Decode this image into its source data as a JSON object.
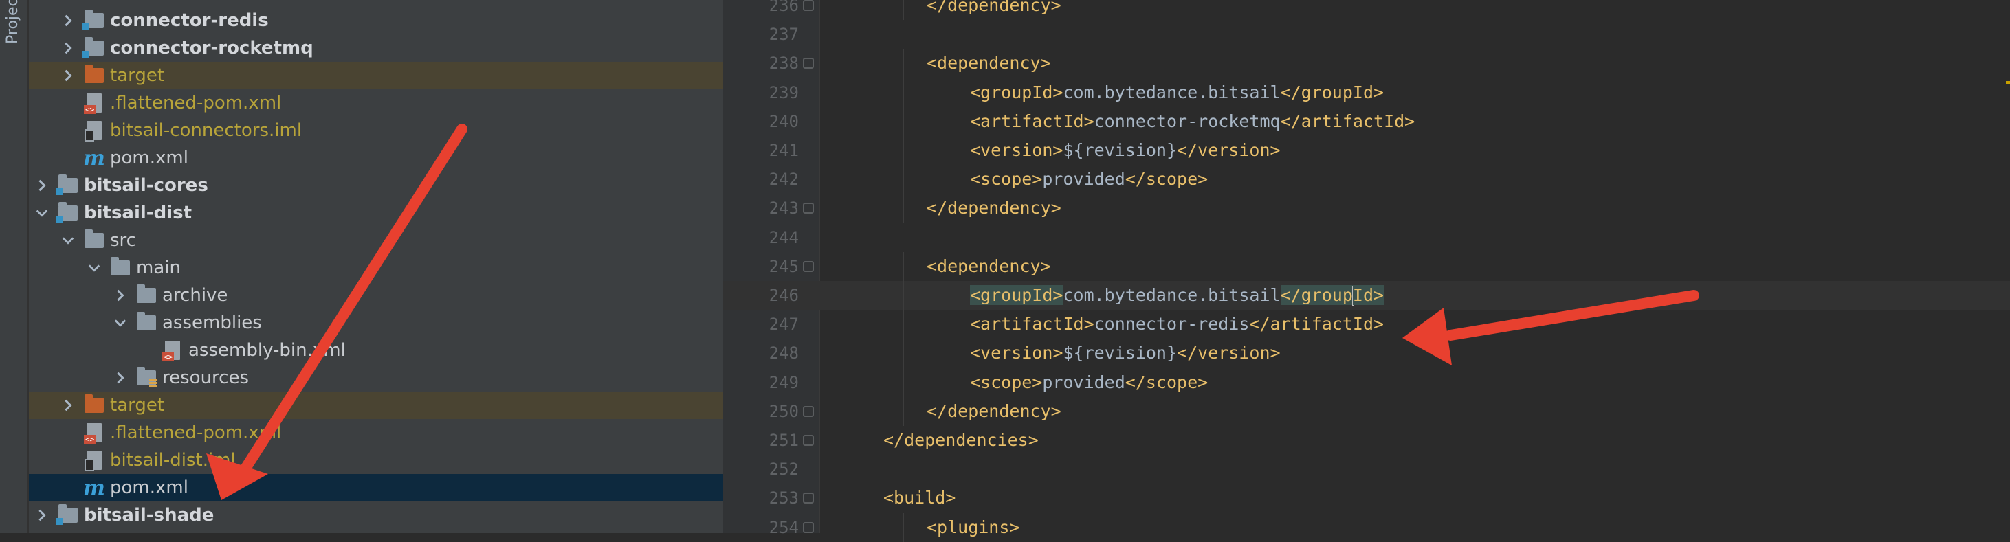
{
  "tool_window": {
    "label": "Project"
  },
  "project_tree": {
    "rows": [
      {
        "label": "connector-redis",
        "kind": "module",
        "indent": 1,
        "expander": "collapsed",
        "style": "bold",
        "state": ""
      },
      {
        "label": "connector-rocketmq",
        "kind": "module",
        "indent": 1,
        "expander": "collapsed",
        "style": "bold",
        "state": ""
      },
      {
        "label": "target",
        "kind": "folder-orange",
        "indent": 1,
        "expander": "collapsed",
        "style": "olive",
        "state": "excluded"
      },
      {
        "label": ".flattened-pom.xml",
        "kind": "xml",
        "indent": 1,
        "expander": "none",
        "style": "olive",
        "state": ""
      },
      {
        "label": "bitsail-connectors.iml",
        "kind": "iml",
        "indent": 1,
        "expander": "none",
        "style": "olive",
        "state": ""
      },
      {
        "label": "pom.xml",
        "kind": "maven",
        "indent": 1,
        "expander": "none",
        "style": "normal",
        "state": ""
      },
      {
        "label": "bitsail-cores",
        "kind": "module",
        "indent": 0,
        "expander": "collapsed",
        "style": "bold",
        "state": ""
      },
      {
        "label": "bitsail-dist",
        "kind": "module",
        "indent": 0,
        "expander": "expanded",
        "style": "bold",
        "state": ""
      },
      {
        "label": "src",
        "kind": "folder",
        "indent": 1,
        "expander": "expanded",
        "style": "normal",
        "state": ""
      },
      {
        "label": "main",
        "kind": "folder",
        "indent": 2,
        "expander": "expanded",
        "style": "normal",
        "state": ""
      },
      {
        "label": "archive",
        "kind": "folder",
        "indent": 3,
        "expander": "collapsed",
        "style": "normal",
        "state": ""
      },
      {
        "label": "assemblies",
        "kind": "folder",
        "indent": 3,
        "expander": "expanded",
        "style": "normal",
        "state": ""
      },
      {
        "label": "assembly-bin.xml",
        "kind": "xml",
        "indent": 4,
        "expander": "none",
        "style": "normal",
        "state": ""
      },
      {
        "label": "resources",
        "kind": "folder-res",
        "indent": 3,
        "expander": "collapsed",
        "style": "normal",
        "state": ""
      },
      {
        "label": "target",
        "kind": "folder-orange",
        "indent": 1,
        "expander": "collapsed",
        "style": "olive",
        "state": "excluded"
      },
      {
        "label": ".flattened-pom.xml",
        "kind": "xml",
        "indent": 1,
        "expander": "none",
        "style": "olive",
        "state": ""
      },
      {
        "label": "bitsail-dist.iml",
        "kind": "iml",
        "indent": 1,
        "expander": "none",
        "style": "olive",
        "state": ""
      },
      {
        "label": "pom.xml",
        "kind": "maven",
        "indent": 1,
        "expander": "none",
        "style": "normal",
        "state": "selected"
      },
      {
        "label": "bitsail-shade",
        "kind": "module",
        "indent": 0,
        "expander": "collapsed",
        "style": "bold",
        "state": ""
      }
    ]
  },
  "editor": {
    "caret_line": "246",
    "lines": [
      {
        "num": "236",
        "indent": 2,
        "fold": true,
        "tokens": [
          {
            "t": "tag",
            "v": "</dependency>"
          }
        ]
      },
      {
        "num": "237",
        "indent": 0,
        "fold": false,
        "tokens": []
      },
      {
        "num": "238",
        "indent": 2,
        "fold": true,
        "tokens": [
          {
            "t": "tag",
            "v": "<dependency>"
          }
        ]
      },
      {
        "num": "239",
        "indent": 3,
        "fold": false,
        "tokens": [
          {
            "t": "tag",
            "v": "<groupId>"
          },
          {
            "t": "txt",
            "v": "com.bytedance.bitsail"
          },
          {
            "t": "tag",
            "v": "</groupId>"
          }
        ]
      },
      {
        "num": "240",
        "indent": 3,
        "fold": false,
        "tokens": [
          {
            "t": "tag",
            "v": "<artifactId>"
          },
          {
            "t": "txt",
            "v": "connector-rocketmq"
          },
          {
            "t": "tag",
            "v": "</artifactId>"
          }
        ]
      },
      {
        "num": "241",
        "indent": 3,
        "fold": false,
        "tokens": [
          {
            "t": "tag",
            "v": "<version>"
          },
          {
            "t": "txt",
            "v": "${revision}"
          },
          {
            "t": "tag",
            "v": "</version>"
          }
        ]
      },
      {
        "num": "242",
        "indent": 3,
        "fold": false,
        "tokens": [
          {
            "t": "tag",
            "v": "<scope>"
          },
          {
            "t": "txt",
            "v": "provided"
          },
          {
            "t": "tag",
            "v": "</scope>"
          }
        ]
      },
      {
        "num": "243",
        "indent": 2,
        "fold": true,
        "tokens": [
          {
            "t": "tag",
            "v": "</dependency>"
          }
        ]
      },
      {
        "num": "244",
        "indent": 0,
        "fold": false,
        "tokens": []
      },
      {
        "num": "245",
        "indent": 2,
        "fold": true,
        "tokens": [
          {
            "t": "tag",
            "v": "<dependency>"
          }
        ]
      },
      {
        "num": "246",
        "indent": 3,
        "fold": false,
        "tokens": [
          {
            "t": "taghl",
            "v": "<groupId>"
          },
          {
            "t": "txt",
            "v": "com.bytedance.bitsail"
          },
          {
            "t": "taghl",
            "v": "</group"
          },
          {
            "t": "caret",
            "v": ""
          },
          {
            "t": "taghl",
            "v": "Id>"
          }
        ]
      },
      {
        "num": "247",
        "indent": 3,
        "fold": false,
        "tokens": [
          {
            "t": "tag",
            "v": "<artifactId>"
          },
          {
            "t": "txt",
            "v": "connector-redis"
          },
          {
            "t": "tag",
            "v": "</artifactId>"
          }
        ]
      },
      {
        "num": "248",
        "indent": 3,
        "fold": false,
        "tokens": [
          {
            "t": "tag",
            "v": "<version>"
          },
          {
            "t": "txt",
            "v": "${revision}"
          },
          {
            "t": "tag",
            "v": "</version>"
          }
        ]
      },
      {
        "num": "249",
        "indent": 3,
        "fold": false,
        "tokens": [
          {
            "t": "tag",
            "v": "<scope>"
          },
          {
            "t": "txt",
            "v": "provided"
          },
          {
            "t": "tag",
            "v": "</scope>"
          }
        ]
      },
      {
        "num": "250",
        "indent": 2,
        "fold": true,
        "tokens": [
          {
            "t": "tag",
            "v": "</dependency>"
          }
        ]
      },
      {
        "num": "251",
        "indent": 1,
        "fold": true,
        "tokens": [
          {
            "t": "tag",
            "v": "</dependencies>"
          }
        ]
      },
      {
        "num": "252",
        "indent": 0,
        "fold": false,
        "tokens": []
      },
      {
        "num": "253",
        "indent": 1,
        "fold": true,
        "tokens": [
          {
            "t": "tag",
            "v": "<build>"
          }
        ]
      },
      {
        "num": "254",
        "indent": 2,
        "fold": true,
        "tokens": [
          {
            "t": "tag",
            "v": "<plugins>"
          }
        ]
      }
    ]
  },
  "annotations": {
    "arrow_color": "#e8402f"
  },
  "colors": {
    "tag": "#e8bf6a",
    "text": "#a9b7c6",
    "excluded_bg": "#4a4432",
    "selected_bg": "#0d293e"
  }
}
